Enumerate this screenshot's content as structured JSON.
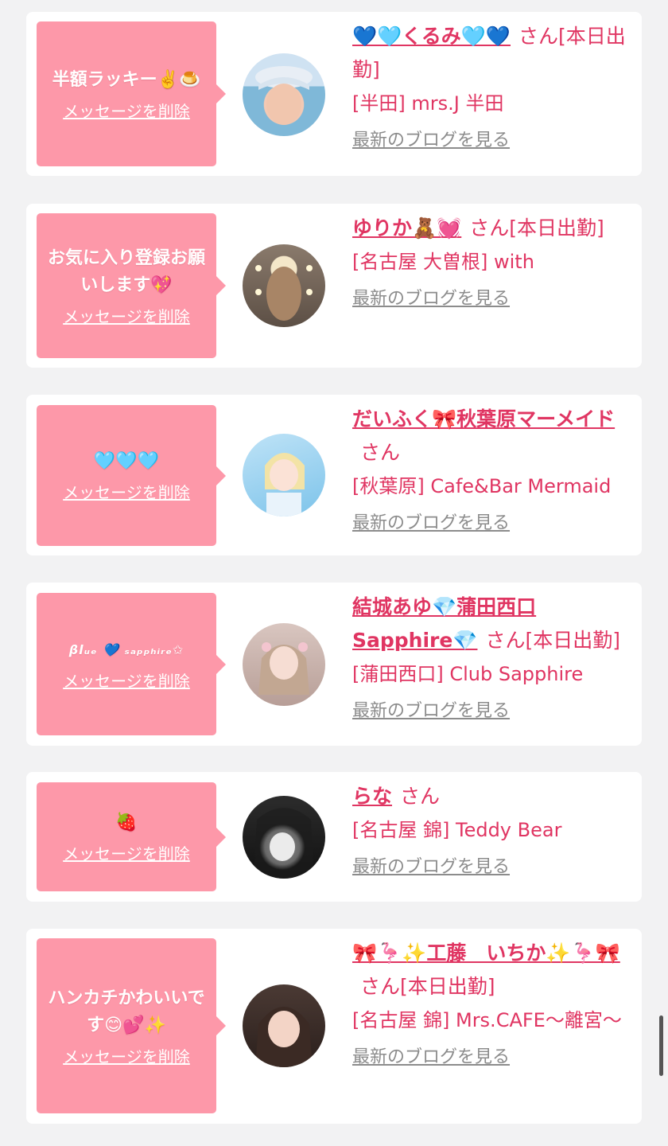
{
  "delete_label": "メッセージを削除",
  "san_label": "さん",
  "blog_label": "最新のブログを見る",
  "colors": {
    "bubble": "#fd98a9",
    "accent": "#e03562",
    "link_gray": "#8c8c8c"
  },
  "cards": [
    {
      "message": "半額ラッキー✌️🍮",
      "name": "💙🩵くるみ🩵💙",
      "status": "[本日出勤]",
      "shop": "[半田] mrs.J 半田",
      "avatar_icon": "avatar-photo"
    },
    {
      "message": "お気に入り登録お願いします💖",
      "name": "ゆりか🧸💓",
      "status": "[本日出勤]",
      "shop": "[名古屋 大曽根] with",
      "avatar_icon": "avatar-photo"
    },
    {
      "message": "🩵🩵🩵",
      "name": "だいふく🎀秋葉原マーメイド",
      "status": "",
      "shop": "[秋葉原] Cafe&Bar Mermaid",
      "avatar_icon": "avatar-photo"
    },
    {
      "message": "βlᵤₑ 💙 ₛₐₚₚₕᵢᵣₑ✩",
      "name": "結城あゆ💎蒲田西口Sapphire💎",
      "status": "[本日出勤]",
      "shop": "[蒲田西口] Club Sapphire",
      "avatar_icon": "avatar-photo"
    },
    {
      "message": "🍓",
      "name": "らな",
      "status": "",
      "shop": "[名古屋 錦] Teddy Bear",
      "avatar_icon": "avatar-photo"
    },
    {
      "message": "ハンカチかわいいです😊💕✨",
      "name": "🎀🦩✨工藤　いちか✨🦩🎀",
      "status": "[本日出勤]",
      "shop": "[名古屋 錦] Mrs.CAFE〜離宮〜",
      "avatar_icon": "avatar-photo"
    }
  ]
}
